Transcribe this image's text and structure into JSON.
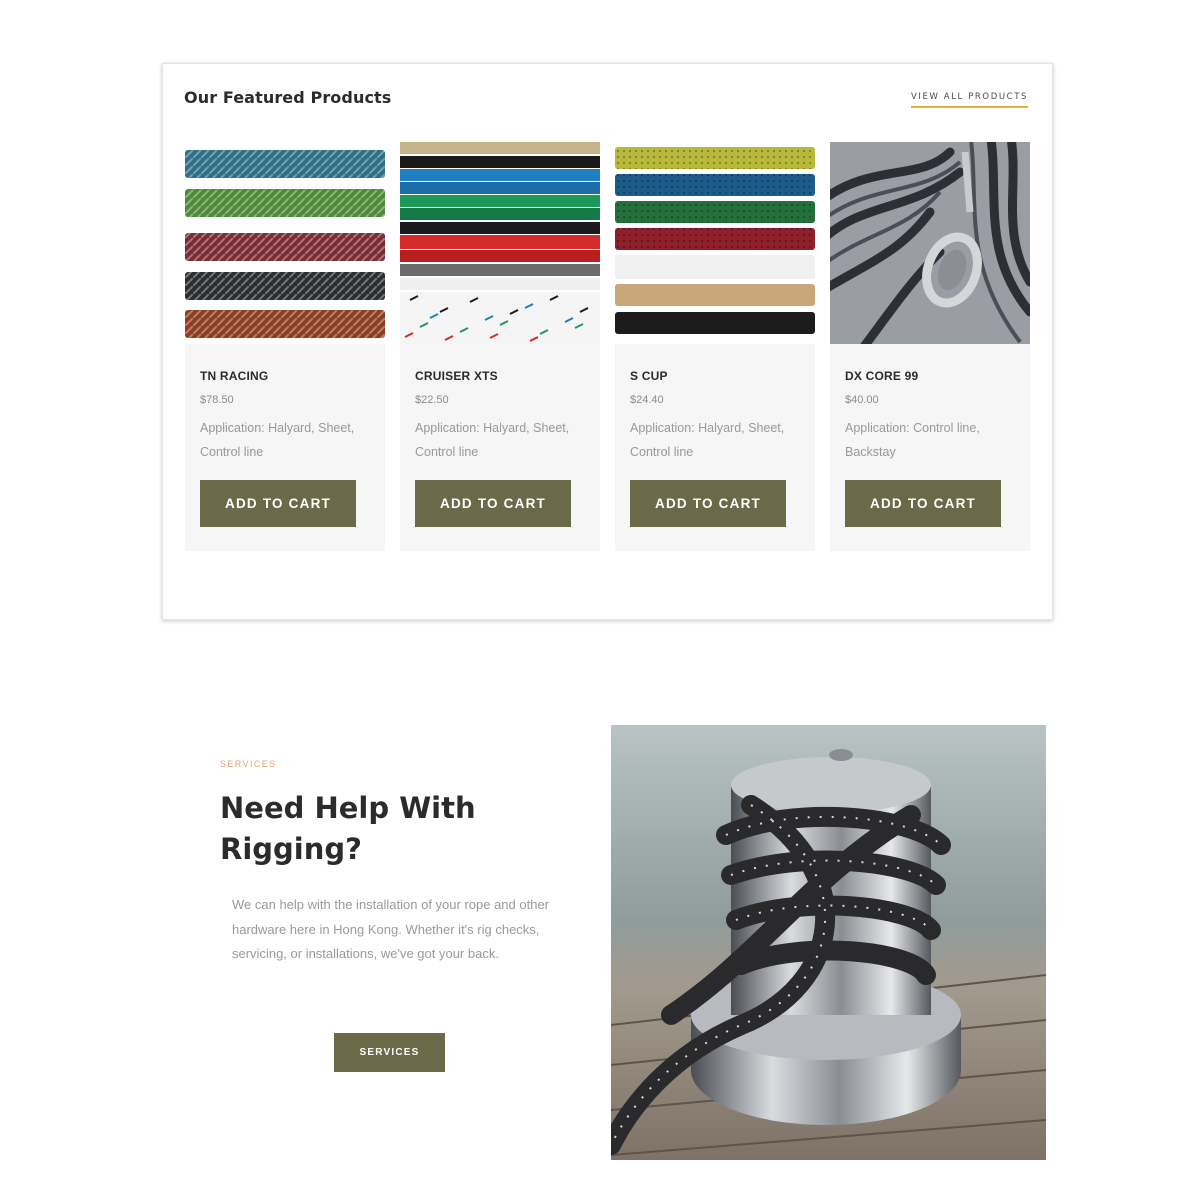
{
  "featured": {
    "title": "Our Featured Products",
    "view_all_label": "VIEW ALL PRODUCTS",
    "accent_color": "#e0b23a",
    "products": [
      {
        "name": "TN RACING",
        "price": "$78.50",
        "application": "Application: Halyard, Sheet, Control line",
        "button_label": "ADD TO CART",
        "image": "braided-rope-samples-colorful"
      },
      {
        "name": "CRUISER XTS",
        "price": "$22.50",
        "application": "Application: Halyard, Sheet, Control line",
        "button_label": "ADD TO CART",
        "image": "braided-rope-samples-solid-colors"
      },
      {
        "name": "S CUP",
        "price": "$24.40",
        "application": "Application: Halyard, Sheet, Control line",
        "button_label": "ADD TO CART",
        "image": "braided-rope-samples-flecked"
      },
      {
        "name": "DX CORE 99",
        "price": "$40.00",
        "application": "Application: Control line, Backstay",
        "button_label": "ADD TO CART",
        "image": "dyneema-rope-with-thimble"
      }
    ]
  },
  "services": {
    "eyebrow": "SERVICES",
    "title": "Need Help With Rigging?",
    "text": "We can help with the installation of your rope and other hardware here in Hong Kong. Whether it's rig checks, servicing, or installations, we've got your back.",
    "button_label": "SERVICES",
    "image": "rope-wrapped-on-sailing-winch"
  },
  "colors": {
    "button": "#6b6a48",
    "eyebrow": "#e8a07a",
    "card_background": "#f7f6f6"
  }
}
